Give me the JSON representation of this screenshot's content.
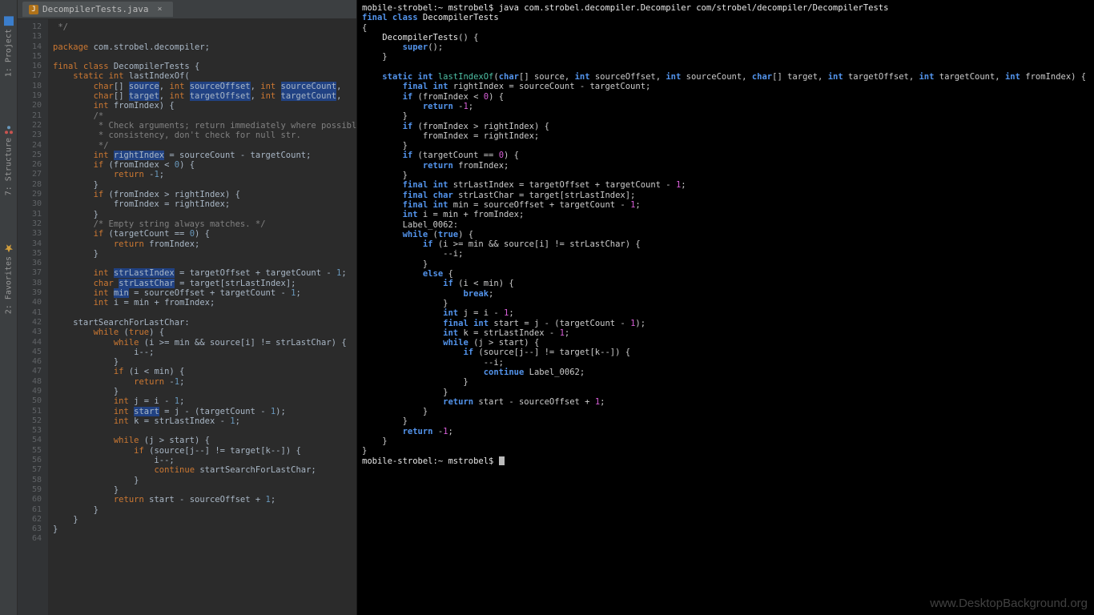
{
  "sidebar": {
    "items": [
      {
        "label": "1: Project"
      },
      {
        "label": "7: Structure"
      },
      {
        "label": "2: Favorites"
      }
    ]
  },
  "tab": {
    "filename": "DecompilerTests.java",
    "icon_letter": "J"
  },
  "watermark": "www.DesktopBackground.org",
  "gutter": {
    "start": 12,
    "end": 64
  },
  "editor_code_html": "<span class='cm'> */</span>\n\n<span class='kw'>package</span> com.strobel.decompiler;\n\n<span class='kw'>final</span> <span class='kw'>class</span> DecompilerTests {\n    <span class='kw'>static</span> <span class='kw'>int</span> lastIndexOf(\n        <span class='kw'>char</span>[] <span class='hl'>source</span>, <span class='kw'>int</span> <span class='hl'>sourceOffset</span>, <span class='kw'>int</span> <span class='hl'>sourceCount</span>,\n        <span class='kw'>char</span>[] <span class='hl'>target</span>, <span class='kw'>int</span> <span class='hl'>targetOffset</span>, <span class='kw'>int</span> <span class='hl'>targetCount</span>,\n        <span class='kw'>int</span> fromIndex) {\n        <span class='cm'>/*</span>\n        <span class='cm'> * Check arguments; return immediately where possible. For</span>\n        <span class='cm'> * consistency, don't check for null str.</span>\n        <span class='cm'> */</span>\n        <span class='kw'>int</span> <span class='hl'>rightIndex</span> = sourceCount - targetCount;\n        <span class='kw'>if</span> (fromIndex &lt; <span class='num'>0</span>) {\n            <span class='kw'>return</span> -<span class='num'>1</span>;\n        }\n        <span class='kw'>if</span> (fromIndex &gt; rightIndex) {\n            fromIndex = rightIndex;\n        }\n        <span class='cm'>/* Empty string always matches. */</span>\n        <span class='kw'>if</span> (targetCount == <span class='num'>0</span>) {\n            <span class='kw'>return</span> fromIndex;\n        }\n\n        <span class='kw'>int</span> <span class='hl'>strLastIndex</span> = targetOffset + targetCount - <span class='num'>1</span>;\n        <span class='kw'>char</span> <span class='hl'>strLastChar</span> = target[strLastIndex];\n        <span class='kw'>int</span> <span class='hl'>min</span> = sourceOffset + targetCount - <span class='num'>1</span>;\n        <span class='kw'>int</span> i = min + fromIndex;\n\n    startSearchForLastChar:\n        <span class='kw'>while</span> (<span class='kw'>true</span>) {\n            <span class='kw'>while</span> (i &gt;= min &amp;&amp; source[i] != strLastChar) {\n                i--;\n            }\n            <span class='kw'>if</span> (i &lt; min) {\n                <span class='kw'>return</span> -<span class='num'>1</span>;\n            }\n            <span class='kw'>int</span> j = i - <span class='num'>1</span>;\n            <span class='kw'>int</span> <span class='hl'>start</span> = j - (targetCount - <span class='num'>1</span>);\n            <span class='kw'>int</span> k = strLastIndex - <span class='num'>1</span>;\n\n            <span class='kw'>while</span> (j &gt; start) {\n                <span class='kw'>if</span> (source[j--] != target[k--]) {\n                    i--;\n                    <span class='kw'>continue</span> startSearchForLastChar;\n                }\n            }\n            <span class='kw'>return</span> start - sourceOffset + <span class='num'>1</span>;\n        }\n    }\n}\n",
  "terminal": {
    "prompt1": "mobile-strobel:~ mstrobel$ ",
    "cmd1": "java com.strobel.decompiler.Decompiler com/strobel/decompiler/DecompilerTests",
    "prompt2": "mobile-strobel:~ mstrobel$ ",
    "body_html": "<span class='tblue'>final class</span> <span class='twhite'>DecompilerTests</span>\n{\n    <span class='twhite'>DecompilerTests</span>() {\n        <span class='tblue'>super</span>();\n    }\n\n    <span class='tblue'>static int</span> <span class='tcyan'>lastIndexOf</span>(<span class='tblue'>char</span>[] source, <span class='tblue'>int</span> sourceOffset, <span class='tblue'>int</span> sourceCount, <span class='tblue'>char</span>[] target, <span class='tblue'>int</span> targetOffset, <span class='tblue'>int</span> targetCount, <span class='tblue'>int</span> fromIndex) {\n        <span class='tblue'>final int</span> rightIndex = sourceCount - targetCount;\n        <span class='tblue'>if</span> (fromIndex &lt; <span class='tnum'>0</span>) {\n            <span class='tblue'>return</span> -<span class='tnum'>1</span>;\n        }\n        <span class='tblue'>if</span> (fromIndex &gt; rightIndex) {\n            fromIndex = rightIndex;\n        }\n        <span class='tblue'>if</span> (targetCount == <span class='tnum'>0</span>) {\n            <span class='tblue'>return</span> fromIndex;\n        }\n        <span class='tblue'>final int</span> strLastIndex = targetOffset + targetCount - <span class='tnum'>1</span>;\n        <span class='tblue'>final char</span> strLastChar = target[strLastIndex];\n        <span class='tblue'>final int</span> min = sourceOffset + targetCount - <span class='tnum'>1</span>;\n        <span class='tblue'>int</span> i = min + fromIndex;\n        Label_0062:\n        <span class='tblue'>while</span> (<span class='tblue'>true</span>) {\n            <span class='tblue'>if</span> (i &gt;= min &amp;&amp; source[i] != strLastChar) {\n                --i;\n            }\n            <span class='tblue'>else</span> {\n                <span class='tblue'>if</span> (i &lt; min) {\n                    <span class='tblue'>break</span>;\n                }\n                <span class='tblue'>int</span> j = i - <span class='tnum'>1</span>;\n                <span class='tblue'>final int</span> start = j - (targetCount - <span class='tnum'>1</span>);\n                <span class='tblue'>int</span> k = strLastIndex - <span class='tnum'>1</span>;\n                <span class='tblue'>while</span> (j &gt; start) {\n                    <span class='tblue'>if</span> (source[j--] != target[k--]) {\n                        --i;\n                        <span class='tblue'>continue</span> Label_0062;\n                    }\n                }\n                <span class='tblue'>return</span> start - sourceOffset + <span class='tnum'>1</span>;\n            }\n        }\n        <span class='tblue'>return</span> -<span class='tnum'>1</span>;\n    }\n}"
  }
}
